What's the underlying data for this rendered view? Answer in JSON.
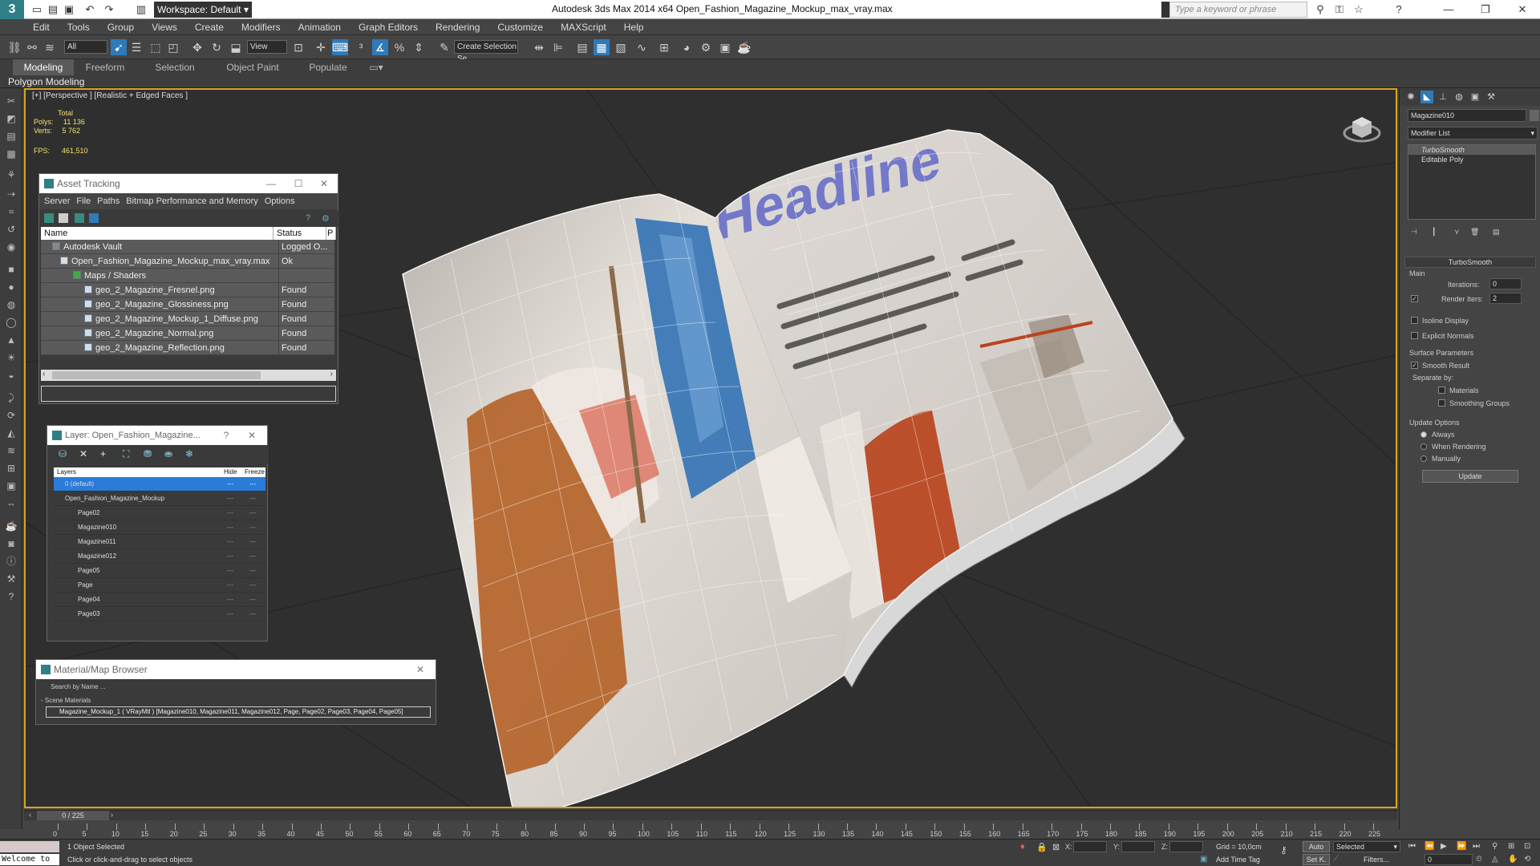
{
  "titlebar": {
    "workspace": "Workspace: Default",
    "title": "Autodesk 3ds Max  2014 x64     Open_Fashion_Magazine_Mockup_max_vray.max",
    "search_placeholder": "Type a keyword or phrase"
  },
  "menu": [
    "Edit",
    "Tools",
    "Group",
    "Views",
    "Create",
    "Modifiers",
    "Animation",
    "Graph Editors",
    "Rendering",
    "Customize",
    "MAXScript",
    "Help"
  ],
  "toolbar": {
    "filter": "All",
    "view": "View",
    "selection_set": "Create Selection Se"
  },
  "ribbon": {
    "tabs": [
      "Modeling",
      "Freeform",
      "Selection",
      "Object Paint",
      "Populate"
    ],
    "subtab": "Polygon Modeling"
  },
  "viewport": {
    "label": "[+] [Perspective ] [Realistic + Edged Faces ]",
    "stats": {
      "total_label": "Total",
      "polys_label": "Polys:",
      "polys": "11 136",
      "verts_label": "Verts:",
      "verts": "5 762",
      "fps_label": "FPS:",
      "fps": "461,510"
    },
    "headline": "Headline"
  },
  "asset_tracking": {
    "title": "Asset Tracking",
    "menu": [
      "Server",
      "File",
      "Paths",
      "Bitmap Performance and Memory",
      "Options"
    ],
    "col_name": "Name",
    "col_status": "Status",
    "col_p": "P",
    "rows": [
      {
        "name": "Autodesk Vault",
        "status": "Logged O..."
      },
      {
        "name": "Open_Fashion_Magazine_Mockup_max_vray.max",
        "status": "Ok"
      },
      {
        "name": "Maps / Shaders",
        "status": ""
      },
      {
        "name": "geo_2_Magazine_Fresnel.png",
        "status": "Found"
      },
      {
        "name": "geo_2_Magazine_Glossiness.png",
        "status": "Found"
      },
      {
        "name": "geo_2_Magazine_Mockup_1_Diffuse.png",
        "status": "Found"
      },
      {
        "name": "geo_2_Magazine_Normal.png",
        "status": "Found"
      },
      {
        "name": "geo_2_Magazine_Reflection.png",
        "status": "Found"
      }
    ]
  },
  "layer_manager": {
    "title": "Layer: Open_Fashion_Magazine...",
    "col_layers": "Layers",
    "col_hide": "Hide",
    "col_freeze": "Freeze",
    "dash": "---",
    "rows": [
      "0 (default)",
      "Open_Fashion_Magazine_Mockup",
      "Page02",
      "Magazine010",
      "Magazine011",
      "Magazine012",
      "Page05",
      "Page",
      "Page04",
      "Page03"
    ]
  },
  "material_browser": {
    "title": "Material/Map Browser",
    "search": "Search by Name ...",
    "group": "- Scene Materials",
    "item": "Magazine_Mockup_1  ( VRayMtl )  [Magazine010, Magazine011, Magazine012, Page, Page02, Page03, Page04, Page05]"
  },
  "command_panel": {
    "object_name": "Magazine010",
    "modifier_list": "Modifier List",
    "stack": [
      "TurboSmooth",
      "Editable Poly"
    ],
    "rollout": "TurboSmooth",
    "main": "Main",
    "iterations_label": "Iterations:",
    "iterations": "0",
    "render_iters_label": "Render Iters:",
    "render_iters": "2",
    "isoline": "Isoline Display",
    "explicit_normals": "Explicit Normals",
    "surface_params": "Surface Parameters",
    "smooth_result": "Smooth Result",
    "separate_by": "Separate by:",
    "materials": "Materials",
    "smoothing_groups": "Smoothing Groups",
    "update_options": "Update Options",
    "always": "Always",
    "when_rendering": "When Rendering",
    "manually": "Manually",
    "update": "Update"
  },
  "timeline": {
    "frame": "0 / 225",
    "ticks": [
      "0",
      "5",
      "10",
      "15",
      "20",
      "25",
      "30",
      "35",
      "40",
      "45",
      "50",
      "55",
      "60",
      "65",
      "70",
      "75",
      "80",
      "85",
      "90",
      "95",
      "100",
      "105",
      "110",
      "115",
      "120",
      "125",
      "130",
      "135",
      "140",
      "145",
      "150",
      "155",
      "160",
      "165",
      "170",
      "175",
      "180",
      "185",
      "190",
      "195",
      "200",
      "205",
      "210",
      "215",
      "220",
      "225"
    ]
  },
  "status": {
    "welcome": "Welcome to",
    "selected": "1 Object Selected",
    "prompt": "Click or click-and-drag to select objects",
    "x_label": "X:",
    "y_label": "Y:",
    "z_label": "Z:",
    "grid": "Grid = 10,0cm",
    "add_time_tag": "Add Time Tag",
    "auto": "Auto",
    "selected_dd": "Selected",
    "setk": "Set K.",
    "filters": "Filters...",
    "frame_field": "0"
  }
}
